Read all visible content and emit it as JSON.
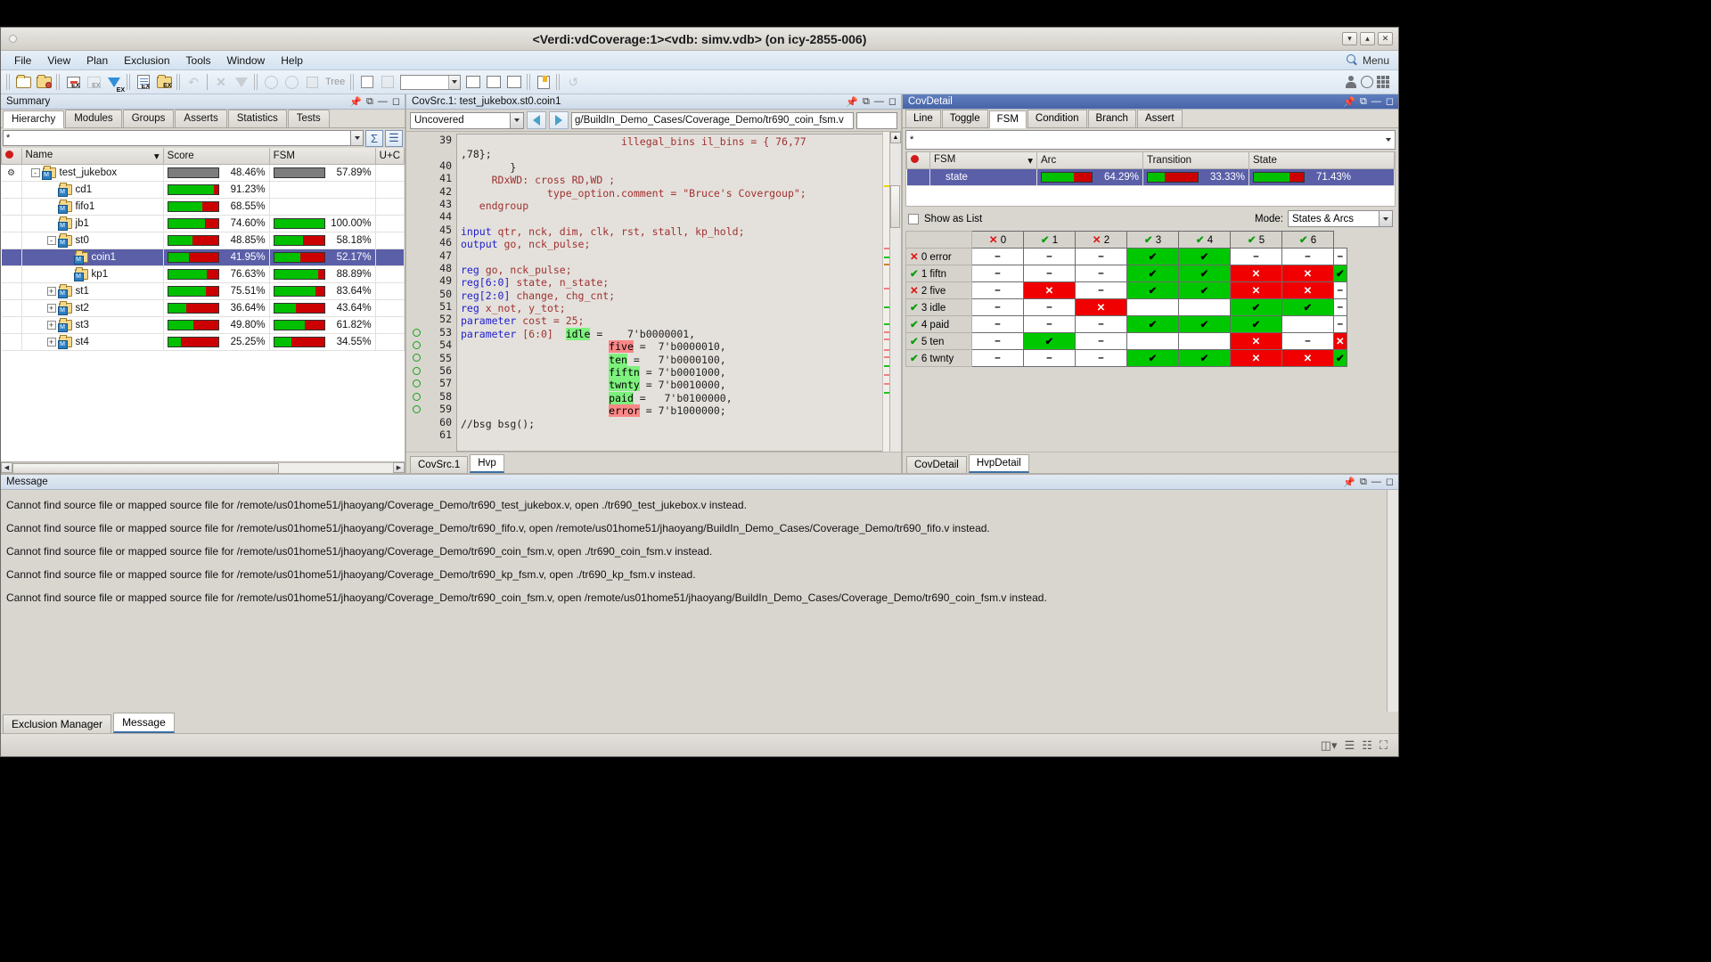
{
  "window": {
    "title": "<Verdi:vdCoverage:1><vdb: simv.vdb> (on icy-2855-006)",
    "buttons": [
      "▾",
      "▴",
      "✕"
    ]
  },
  "menubar": {
    "items": [
      "File",
      "View",
      "Plan",
      "Exclusion",
      "Tools",
      "Window",
      "Help"
    ],
    "search_label": "Menu"
  },
  "toolbar": {
    "tree_label": "Tree",
    "combo_value": ""
  },
  "summary": {
    "title": "Summary",
    "tabs": [
      "Hierarchy",
      "Modules",
      "Groups",
      "Asserts",
      "Statistics",
      "Tests"
    ],
    "selected_tab": "Hierarchy",
    "filter_value": "*",
    "columns": [
      "Name",
      "Score",
      "FSM",
      "U+C"
    ],
    "rows": [
      {
        "name": "test_jukebox",
        "indent": 0,
        "expander": "-",
        "score": "48.46%",
        "score_pct": 48.46,
        "score_gray": true,
        "fsm": "57.89%",
        "fsm_pct": 57.89,
        "fsm_gray": true,
        "selected": false,
        "has_gear": true
      },
      {
        "name": "cd1",
        "indent": 1,
        "expander": "",
        "score": "91.23%",
        "score_pct": 91.23,
        "score_gray": false,
        "fsm": "",
        "fsm_pct": null,
        "fsm_gray": false,
        "selected": false,
        "has_gear": false
      },
      {
        "name": "fifo1",
        "indent": 1,
        "expander": "",
        "score": "68.55%",
        "score_pct": 68.55,
        "score_gray": false,
        "fsm": "",
        "fsm_pct": null,
        "fsm_gray": false,
        "selected": false,
        "has_gear": false
      },
      {
        "name": "jb1",
        "indent": 1,
        "expander": "",
        "score": "74.60%",
        "score_pct": 74.6,
        "score_gray": false,
        "fsm": "100.00%",
        "fsm_pct": 100.0,
        "fsm_gray": false,
        "selected": false,
        "has_gear": false
      },
      {
        "name": "st0",
        "indent": 1,
        "expander": "-",
        "score": "48.85%",
        "score_pct": 48.85,
        "score_gray": false,
        "fsm": "58.18%",
        "fsm_pct": 58.18,
        "fsm_gray": false,
        "selected": false,
        "has_gear": false
      },
      {
        "name": "coin1",
        "indent": 2,
        "expander": "",
        "score": "41.95%",
        "score_pct": 41.95,
        "score_gray": false,
        "fsm": "52.17%",
        "fsm_pct": 52.17,
        "fsm_gray": false,
        "selected": true,
        "has_gear": false
      },
      {
        "name": "kp1",
        "indent": 2,
        "expander": "",
        "score": "76.63%",
        "score_pct": 76.63,
        "score_gray": false,
        "fsm": "88.89%",
        "fsm_pct": 88.89,
        "fsm_gray": false,
        "selected": false,
        "has_gear": false
      },
      {
        "name": "st1",
        "indent": 1,
        "expander": "+",
        "score": "75.51%",
        "score_pct": 75.51,
        "score_gray": false,
        "fsm": "83.64%",
        "fsm_pct": 83.64,
        "fsm_gray": false,
        "selected": false,
        "has_gear": false
      },
      {
        "name": "st2",
        "indent": 1,
        "expander": "+",
        "score": "36.64%",
        "score_pct": 36.64,
        "score_gray": false,
        "fsm": "43.64%",
        "fsm_pct": 43.64,
        "fsm_gray": false,
        "selected": false,
        "has_gear": false
      },
      {
        "name": "st3",
        "indent": 1,
        "expander": "+",
        "score": "49.80%",
        "score_pct": 49.8,
        "score_gray": false,
        "fsm": "61.82%",
        "fsm_pct": 61.82,
        "fsm_gray": false,
        "selected": false,
        "has_gear": false
      },
      {
        "name": "st4",
        "indent": 1,
        "expander": "+",
        "score": "25.25%",
        "score_pct": 25.25,
        "score_gray": false,
        "fsm": "34.55%",
        "fsm_pct": 34.55,
        "fsm_gray": false,
        "selected": false,
        "has_gear": false
      }
    ]
  },
  "source": {
    "title": "CovSrc.1: test_jukebox.st0.coin1",
    "filter_value": "Uncovered",
    "path_value": "g/BuildIn_Demo_Cases/Coverage_Demo/tr690_coin_fsm.v",
    "small_value": "",
    "tabs": [
      "CovSrc.1",
      "Hvp"
    ],
    "selected_tab": "Hvp",
    "lines": [
      {
        "num": "39",
        "cov": false,
        "segments": [
          {
            "t": "                          ",
            "c": "pl"
          },
          {
            "t": "illegal_bins il_bins = { 76,77",
            "c": "id"
          }
        ]
      },
      {
        "num": "",
        "cov": false,
        "segments": [
          {
            "t": ",78};",
            "c": "pl"
          }
        ]
      },
      {
        "num": "40",
        "cov": false,
        "segments": [
          {
            "t": "        }",
            "c": "pl"
          }
        ]
      },
      {
        "num": "41",
        "cov": false,
        "segments": [
          {
            "t": "     RDxWD: cross RD,WD ;",
            "c": "id"
          }
        ]
      },
      {
        "num": "42",
        "cov": false,
        "segments": [
          {
            "t": "              type_option.comment = \"Bruce's Covergoup\";",
            "c": "id"
          }
        ]
      },
      {
        "num": "43",
        "cov": false,
        "segments": [
          {
            "t": "   endgroup",
            "c": "id"
          }
        ]
      },
      {
        "num": "44",
        "cov": false,
        "segments": [
          {
            "t": "",
            "c": "pl"
          }
        ]
      },
      {
        "num": "45",
        "cov": false,
        "segments": [
          {
            "t": "input",
            "c": "kw"
          },
          {
            "t": " qtr, nck, dim, clk, rst, stall, kp_hold;",
            "c": "id"
          }
        ]
      },
      {
        "num": "46",
        "cov": false,
        "segments": [
          {
            "t": "output",
            "c": "kw"
          },
          {
            "t": " go, nck_pulse;",
            "c": "id"
          }
        ]
      },
      {
        "num": "47",
        "cov": false,
        "segments": [
          {
            "t": "",
            "c": "pl"
          }
        ]
      },
      {
        "num": "48",
        "cov": false,
        "segments": [
          {
            "t": "reg",
            "c": "kw"
          },
          {
            "t": " go, nck_pulse;",
            "c": "id"
          }
        ]
      },
      {
        "num": "49",
        "cov": false,
        "segments": [
          {
            "t": "reg[6:0]",
            "c": "kw"
          },
          {
            "t": " state, n_state;",
            "c": "id"
          }
        ]
      },
      {
        "num": "50",
        "cov": false,
        "segments": [
          {
            "t": "reg[2:0]",
            "c": "kw"
          },
          {
            "t": " change, chg_cnt;",
            "c": "id"
          }
        ]
      },
      {
        "num": "51",
        "cov": false,
        "segments": [
          {
            "t": "reg",
            "c": "kw"
          },
          {
            "t": " x_not, y_tot;",
            "c": "id"
          }
        ]
      },
      {
        "num": "52",
        "cov": false,
        "segments": [
          {
            "t": "parameter",
            "c": "kw"
          },
          {
            "t": " cost = 25;",
            "c": "id"
          }
        ]
      },
      {
        "num": "53",
        "cov": true,
        "segments": [
          {
            "t": "parameter",
            "c": "kw"
          },
          {
            "t": " [6:0]  ",
            "c": "id"
          },
          {
            "t": "idle",
            "c": "hl-g"
          },
          {
            "t": " =    7'b0000001,",
            "c": "pl"
          }
        ]
      },
      {
        "num": "54",
        "cov": true,
        "segments": [
          {
            "t": "                        ",
            "c": "pl"
          },
          {
            "t": "five",
            "c": "hl-r"
          },
          {
            "t": " =  7'b0000010,",
            "c": "pl"
          }
        ]
      },
      {
        "num": "55",
        "cov": true,
        "segments": [
          {
            "t": "                        ",
            "c": "pl"
          },
          {
            "t": "ten",
            "c": "hl-g"
          },
          {
            "t": " =   7'b0000100,",
            "c": "pl"
          }
        ]
      },
      {
        "num": "56",
        "cov": true,
        "segments": [
          {
            "t": "                        ",
            "c": "pl"
          },
          {
            "t": "fiftn",
            "c": "hl-g"
          },
          {
            "t": " = 7'b0001000,",
            "c": "pl"
          }
        ]
      },
      {
        "num": "57",
        "cov": true,
        "segments": [
          {
            "t": "                        ",
            "c": "pl"
          },
          {
            "t": "twnty",
            "c": "hl-g"
          },
          {
            "t": " = 7'b0010000,",
            "c": "pl"
          }
        ]
      },
      {
        "num": "58",
        "cov": true,
        "segments": [
          {
            "t": "                        ",
            "c": "pl"
          },
          {
            "t": "paid",
            "c": "hl-g"
          },
          {
            "t": " =   7'b0100000,",
            "c": "pl"
          }
        ]
      },
      {
        "num": "59",
        "cov": true,
        "segments": [
          {
            "t": "                        ",
            "c": "pl"
          },
          {
            "t": "error",
            "c": "hl-r"
          },
          {
            "t": " = 7'b1000000;",
            "c": "pl"
          }
        ]
      },
      {
        "num": "60",
        "cov": false,
        "segments": [
          {
            "t": "//bsg bsg();",
            "c": "pl"
          }
        ]
      },
      {
        "num": "61",
        "cov": false,
        "segments": [
          {
            "t": "",
            "c": "pl"
          }
        ]
      }
    ]
  },
  "detail": {
    "title": "CovDetail",
    "tabs": [
      "Line",
      "Toggle",
      "FSM",
      "Condition",
      "Branch",
      "Assert"
    ],
    "selected_tab": "FSM",
    "filter_value": "*",
    "columns": [
      "FSM",
      "Arc",
      "Transition",
      "State"
    ],
    "rows": [
      {
        "name": "state",
        "arc": "64.29%",
        "arc_pct": 64.29,
        "transition": "33.33%",
        "transition_pct": 33.33,
        "state": "71.43%",
        "state_pct": 71.43,
        "selected": true
      }
    ],
    "show_as_list_label": "Show as List",
    "show_as_list_checked": false,
    "mode_label": "Mode:",
    "mode_value": "States & Arcs",
    "tabs2": [
      "CovDetail",
      "HvpDetail"
    ],
    "selected_tab2": "HvpDetail",
    "matrix": {
      "col_headers": [
        {
          "mark": "x",
          "label": "0"
        },
        {
          "mark": "ok",
          "label": "1"
        },
        {
          "mark": "x",
          "label": "2"
        },
        {
          "mark": "ok",
          "label": "3"
        },
        {
          "mark": "ok",
          "label": "4"
        },
        {
          "mark": "ok",
          "label": "5"
        },
        {
          "mark": "ok",
          "label": "6"
        }
      ],
      "rows": [
        {
          "mark": "x",
          "label": "0 error",
          "cells": [
            "dash",
            "dash",
            "dash",
            "tick-g",
            "tick-g",
            "dash",
            "dash",
            "dash"
          ]
        },
        {
          "mark": "ok",
          "label": "1 fiftn",
          "cells": [
            "dash",
            "dash",
            "dash",
            "tick-g",
            "tick-g",
            "x-r",
            "x-r",
            "tick-g"
          ]
        },
        {
          "mark": "x",
          "label": "2 five",
          "cells": [
            "dash",
            "x-r",
            "dash",
            "tick-g",
            "tick-g",
            "x-r",
            "x-r",
            "dash"
          ]
        },
        {
          "mark": "ok",
          "label": "3 idle",
          "cells": [
            "dash",
            "dash",
            "x-r",
            "blank",
            "blank",
            "tick-g",
            "tick-g",
            "dash"
          ]
        },
        {
          "mark": "ok",
          "label": "4 paid",
          "cells": [
            "dash",
            "dash",
            "dash",
            "tick-g",
            "tick-g",
            "tick-g",
            "blank",
            "dash"
          ]
        },
        {
          "mark": "ok",
          "label": "5 ten",
          "cells": [
            "dash",
            "tick-g",
            "dash",
            "blank",
            "blank",
            "x-r",
            "dash",
            "x-r"
          ]
        },
        {
          "mark": "ok",
          "label": "6 twnty",
          "cells": [
            "dash",
            "dash",
            "dash",
            "tick-g",
            "tick-g",
            "x-r",
            "x-r",
            "tick-g"
          ]
        }
      ]
    }
  },
  "message": {
    "title": "Message",
    "lines": [
      "Cannot find source file or mapped source file for /remote/us01home51/jhaoyang/Coverage_Demo/tr690_test_jukebox.v, open ./tr690_test_jukebox.v instead.",
      "Cannot find source file or mapped source file for /remote/us01home51/jhaoyang/Coverage_Demo/tr690_fifo.v, open /remote/us01home51/jhaoyang/BuildIn_Demo_Cases/Coverage_Demo/tr690_fifo.v instead.",
      "Cannot find source file or mapped source file for /remote/us01home51/jhaoyang/Coverage_Demo/tr690_coin_fsm.v, open ./tr690_coin_fsm.v instead.",
      "Cannot find source file or mapped source file for /remote/us01home51/jhaoyang/Coverage_Demo/tr690_kp_fsm.v, open ./tr690_kp_fsm.v instead.",
      "Cannot find source file or mapped source file for /remote/us01home51/jhaoyang/Coverage_Demo/tr690_coin_fsm.v, open /remote/us01home51/jhaoyang/BuildIn_Demo_Cases/Coverage_Demo/tr690_coin_fsm.v instead."
    ],
    "tabs": [
      "Exclusion Manager",
      "Message"
    ],
    "selected_tab": "Message"
  },
  "colors": {
    "covered": "#00c800",
    "uncovered": "#f00000",
    "neutral": "#7d7d7d",
    "selection": "#5a5fa8",
    "accent": "#3a6ea5"
  }
}
